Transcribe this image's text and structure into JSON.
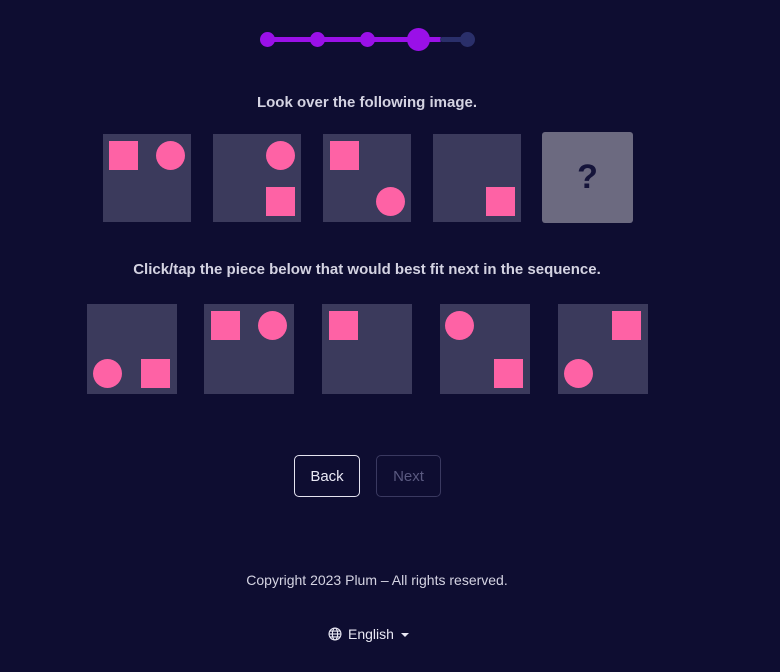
{
  "progress": {
    "total_steps": 5,
    "current_step": 4
  },
  "instructions": {
    "look": "Look over the following image.",
    "choose": "Click/tap the piece below that would best fit next in the sequence."
  },
  "sequence": {
    "unknown_label": "?"
  },
  "buttons": {
    "back": "Back",
    "next": "Next"
  },
  "footer": {
    "copyright": "Copyright 2023 Plum – All rights reserved.",
    "language": "English"
  },
  "colors": {
    "background": "#0e0d31",
    "accent": "#9a10e8",
    "shape": "#fe62a5",
    "tile": "#3b3a5c"
  }
}
